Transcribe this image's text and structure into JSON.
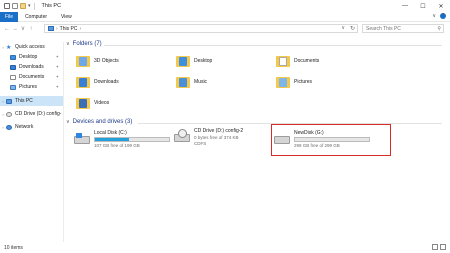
{
  "window": {
    "title": "This PC",
    "controls": {
      "minimize": "—",
      "maximize": "☐",
      "close": "✕"
    }
  },
  "ribbon": {
    "tabs": [
      "File",
      "Computer",
      "View"
    ],
    "expand": "∨",
    "help": "?"
  },
  "nav": {
    "back": "←",
    "forward": "→",
    "recent": "∨",
    "up": "↑",
    "path": "This PC",
    "refresh": "↻",
    "search_placeholder": "Search This PC"
  },
  "sidebar": {
    "items": [
      {
        "label": "Quick access",
        "icon": "star-icon"
      },
      {
        "label": "Desktop",
        "icon": "desktop-icon",
        "pinned": true
      },
      {
        "label": "Downloads",
        "icon": "downloads-icon",
        "pinned": true
      },
      {
        "label": "Documents",
        "icon": "documents-icon",
        "pinned": true
      },
      {
        "label": "Pictures",
        "icon": "pictures-icon",
        "pinned": true
      },
      {
        "label": "This PC",
        "icon": "computer-icon",
        "selected": true
      },
      {
        "label": "CD Drive (D:) config-",
        "icon": "cd-drive-icon"
      },
      {
        "label": "Network",
        "icon": "network-icon"
      }
    ]
  },
  "folders": {
    "header": "Folders (7)",
    "items": [
      {
        "label": "3D Objects",
        "icon": "3d-objects-folder-icon"
      },
      {
        "label": "Desktop",
        "icon": "desktop-folder-icon"
      },
      {
        "label": "Documents",
        "icon": "documents-folder-icon"
      },
      {
        "label": "Downloads",
        "icon": "downloads-folder-icon"
      },
      {
        "label": "Music",
        "icon": "music-folder-icon"
      },
      {
        "label": "Pictures",
        "icon": "pictures-folder-icon"
      },
      {
        "label": "Videos",
        "icon": "videos-folder-icon"
      }
    ]
  },
  "drives": {
    "header": "Devices and drives (3)",
    "items": [
      {
        "name": "Local Disk (C:)",
        "detail": "107 GB free of 199 GB",
        "used_fraction": 0.46,
        "icon": "windows-drive-icon"
      },
      {
        "name": "CD Drive (D:) config-2",
        "detail": "0 bytes free of 374 KB",
        "extra": "CDFS",
        "icon": "cd-drive-icon"
      },
      {
        "name": "NewDisk (G:)",
        "detail": "299 GB free of 299 GB",
        "used_fraction": 0.0,
        "icon": "hard-drive-icon"
      }
    ]
  },
  "status": {
    "count": "10 items"
  },
  "colors": {
    "accent": "#1a6fc9",
    "selection": "#cce4f7",
    "highlight_box": "#d92a2a",
    "bar_fill": "#26a0da"
  }
}
